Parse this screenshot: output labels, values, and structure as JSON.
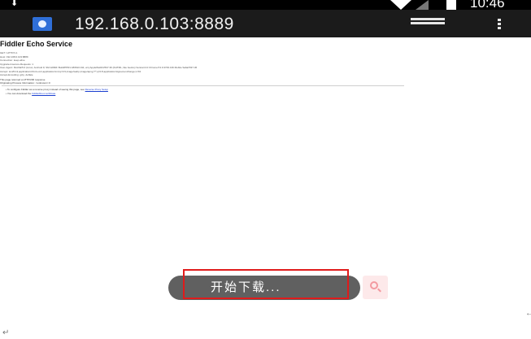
{
  "status_bar": {
    "time": "10:46",
    "download_glyph": "⬇",
    "icons": [
      "download-icon",
      "wifi-icon",
      "signal-icon",
      "battery-icon"
    ]
  },
  "address_bar": {
    "url": "192.168.0.103:8889",
    "icons": [
      "favicon-paw-icon",
      "tabs-icon",
      "overflow-menu-icon"
    ]
  },
  "page": {
    "title": "Fiddler Echo Service",
    "request_lines": [
      "GET / HTTP/1.1",
      "Host: 192.168.0.103:8889",
      "Connection: keep-alive",
      "Upgrade-Insecure-Requests: 1",
      "User-Agent: Mozilla/5.0 (Linux; Android 9; SM-G960F Build/PPR1.180610.011; wv) AppleWebKit/537.36 (KHTML, like Gecko) Version/4.0 Chrome/74.0.3729.136 Mobile Safari/537.36",
      "Accept: text/html,application/xhtml+xml,application/xml;q=0.9,image/webp,image/apng,*/*;q=0.8,application/signed-exchange;v=b3",
      "Accept-Encoding: gzip, deflate",
      "Accept-Language: zh-CN,zh;q=0.9",
      "X-Requested-With: com.android.browser"
    ],
    "info_lines": [
      "This page returned a HTTP/200 response",
      "Originating Process Information: <unknown>:0"
    ],
    "links": [
      {
        "text": "To configure Fiddler as a reverse proxy instead of seeing this page, see ",
        "link": "Reverse Proxy Setup"
      },
      {
        "text": "You can download the ",
        "link": "FiddlerRoot certificate"
      }
    ]
  },
  "download_toast": {
    "label": "开始下载..."
  },
  "accent_colors": {
    "toast_background": "#606060",
    "highlight_border": "#e01b1b",
    "link": "#1a3fd0"
  },
  "marks": {
    "left": "↵",
    "right": "←"
  }
}
